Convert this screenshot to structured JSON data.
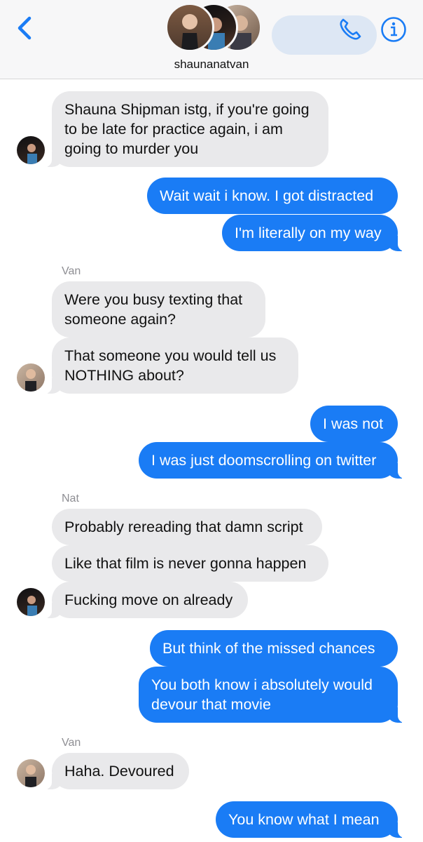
{
  "header": {
    "back_icon": "chevron-left-icon",
    "group_name": "shaunanatvan",
    "phone_icon": "phone-icon",
    "info_icon": "info-icon",
    "accent_color": "#1a7cf5"
  },
  "messages": [
    {
      "sender": "Nat",
      "text": "Shauna Shipman istg, if you're going\nto be late for practice again, i am\ngoing to murder you"
    },
    {
      "sender": "me",
      "text": "Wait wait i know. I got distracted"
    },
    {
      "sender": "me",
      "text": "I'm literally on my way"
    },
    {
      "sender": "Van",
      "text": "Were you busy texting that\nsomeone again?"
    },
    {
      "sender": "Van",
      "text": "That someone you would tell us\nNOTHING about?"
    },
    {
      "sender": "me",
      "text": "I was not"
    },
    {
      "sender": "me",
      "text": "I was just doomscrolling on twitter"
    },
    {
      "sender": "Nat",
      "text": "Probably rereading that damn script"
    },
    {
      "sender": "Nat",
      "text": "Like that film is never gonna happen"
    },
    {
      "sender": "Nat",
      "text": "Fucking move on already"
    },
    {
      "sender": "me",
      "text": "But think of the missed chances"
    },
    {
      "sender": "me",
      "text": "You both know i absolutely would\ndevour that movie"
    },
    {
      "sender": "Van",
      "text": "Haha. Devoured"
    },
    {
      "sender": "me",
      "text": "You know what I mean"
    }
  ],
  "sender_labels": {
    "nat": "Nat",
    "van": "Van",
    "nat_2": "Nat",
    "van_2": "Van"
  }
}
